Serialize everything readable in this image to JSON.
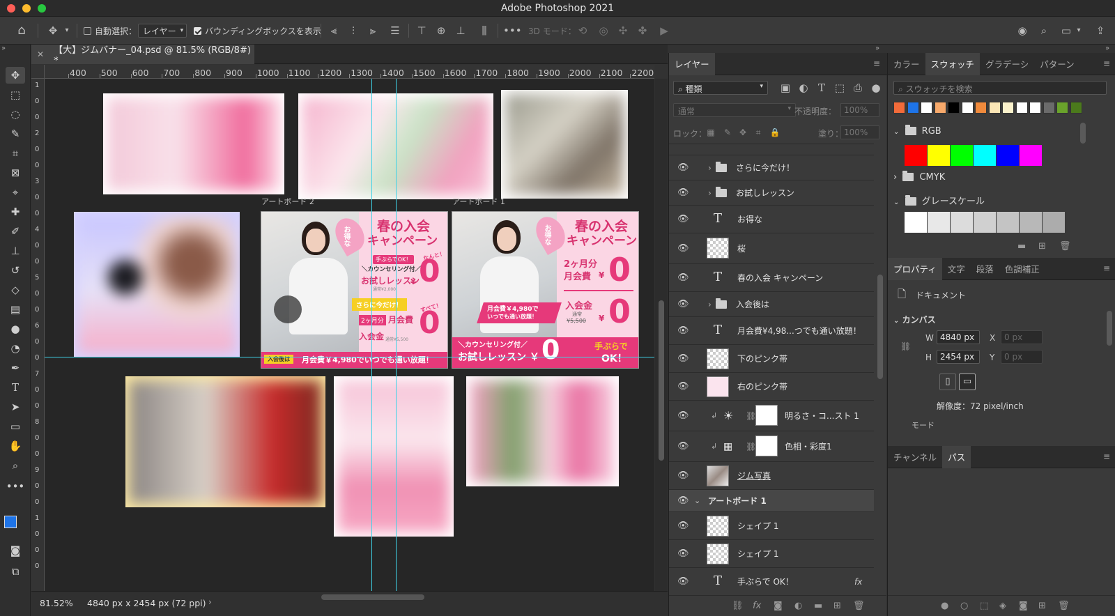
{
  "app": {
    "title": "Adobe Photoshop 2021"
  },
  "options_bar": {
    "auto_select_label": "自動選択：",
    "auto_select_target": "レイヤー",
    "bounding_box_label": "バウンディングボックスを表示",
    "mode_3d_label": "3D モード："
  },
  "document": {
    "tab_title": "【大】ジムバナー_04.psd @ 81.5% (RGB/8#) *",
    "zoom": "81.52%",
    "doc_size": "4840 px x 2454 px (72 ppi)"
  },
  "ruler": {
    "h_labels": [
      "400",
      "500",
      "600",
      "700",
      "800",
      "900",
      "1000",
      "1100",
      "1200",
      "1300",
      "1400",
      "1500",
      "1600",
      "1700",
      "1800",
      "1900",
      "2000",
      "2100",
      "2200"
    ],
    "v_labels": [
      "1",
      "0",
      "0",
      "2",
      "0",
      "0",
      "3",
      "0",
      "0",
      "4",
      "0",
      "0",
      "5",
      "0",
      "0",
      "6",
      "0",
      "0",
      "7",
      "0",
      "0",
      "8",
      "0",
      "0",
      "9",
      "0",
      "0",
      "1",
      "0",
      "0",
      "0"
    ]
  },
  "artboards": {
    "label_2": "アートボード 2",
    "label_1": "アートボード 1"
  },
  "banner_a": {
    "badge": "お得な",
    "headline1": "春の入会",
    "headline2": "キャンペーン",
    "tag": "手ぶらでOK！",
    "lesson_line": "＼カウンセリング付／",
    "lesson": "お試しレッスン",
    "lesson_price": "¥",
    "zero": "0",
    "lesson_note": "通常¥2,000",
    "nanto": "なんと！",
    "today": "さらに今だけ！",
    "subete": "すべて！",
    "months": "2ヶ月分",
    "monthly": "月会費",
    "admission": "入会金",
    "adm_note": "通常¥5,500",
    "footer_tag": "入会後は",
    "footer_text": "月会費￥4,980でいつでも通い放題！"
  },
  "banner_b": {
    "badge": "お得な",
    "headline1": "春の入会",
    "headline2": "キャンペーン",
    "months": "2ヶ月分",
    "monthly": "月会費",
    "yen": "¥",
    "zero": "0",
    "admission": "入会金",
    "adm_note1": "通常",
    "adm_note2": "¥5,500",
    "ribbon1": "月会費￥4,980で",
    "ribbon2": "いつでも通い放題！",
    "footer_line": "＼カウンセリング付／",
    "footer_lesson": "お試しレッスン ￥",
    "footer_zero": "0",
    "footer_ok1": "手ぶらで",
    "footer_ok2": "OK！"
  },
  "layers_panel": {
    "tab": "レイヤー",
    "filter": "種類",
    "blend": "通常",
    "opacity_label": "不透明度：",
    "opacity": "100%",
    "lock_label": "ロック：",
    "fill_label": "塗り：",
    "fill": "100%",
    "rows": [
      {
        "name": "さらに今だけ！",
        "kind": "folder"
      },
      {
        "name": "お試しレッスン",
        "kind": "folder"
      },
      {
        "name": "お得な",
        "kind": "text"
      },
      {
        "name": "桜",
        "kind": "smart"
      },
      {
        "name": "春の入会 キャンペーン",
        "kind": "text"
      },
      {
        "name": "入会後は",
        "kind": "folder"
      },
      {
        "name": "月会費¥4,98...つでも通い放題！",
        "kind": "text"
      },
      {
        "name": "下のピンク帯",
        "kind": "shape"
      },
      {
        "name": "右のピンク帯",
        "kind": "shape"
      },
      {
        "name": "明るさ・コ...スト 1",
        "kind": "adjust"
      },
      {
        "name": "色相・彩度1",
        "kind": "adjust"
      },
      {
        "name": "ジム写真",
        "kind": "photo"
      },
      {
        "name": "アートボード 1",
        "kind": "artboard"
      },
      {
        "name": "シェイプ 1",
        "kind": "shape"
      },
      {
        "name": "シェイプ 1",
        "kind": "shape"
      },
      {
        "name": "手ぶらで OK！",
        "kind": "text"
      }
    ]
  },
  "color_panel": {
    "tabs": [
      "カラー",
      "スウォッチ",
      "グラデーシ",
      "パターン"
    ],
    "search_placeholder": "スウォッチを検索",
    "recent": [
      "#f26b3a",
      "#1e74e8",
      "#ffffff",
      "#f7a96b",
      "#000000",
      "#ffffff",
      "#f08a3c",
      "#fbe6b6",
      "#fbf2cc",
      "#ffffff",
      "#ffffff",
      "#6b6b6b",
      "#6aa32b",
      "#4b7a1c"
    ],
    "groups": [
      "RGB",
      "CMYK",
      "グレースケール"
    ],
    "rgb": [
      "#ff0000",
      "#ffff00",
      "#00ff00",
      "#00ffff",
      "#0000ff",
      "#ff00ff"
    ],
    "gray": [
      "#ffffff",
      "#e8e8e8",
      "#dcdcdc",
      "#d0d0d0",
      "#c4c4c4",
      "#b8b8b8",
      "#acacac"
    ]
  },
  "properties_panel": {
    "tabs": [
      "プロパティ",
      "文字",
      "段落",
      "色調補正"
    ],
    "doc_label": "ドキュメント",
    "canvas_label": "カンバス",
    "w_label": "W",
    "w": "4840 px",
    "h_label": "H",
    "h": "2454 px",
    "x_label": "X",
    "x": "0 px",
    "y_label": "Y",
    "y": "0 px",
    "resolution": "解像度：72 pixel/inch",
    "mode": "モード"
  },
  "channels_panel": {
    "tabs": [
      "チャンネル",
      "パス"
    ]
  }
}
